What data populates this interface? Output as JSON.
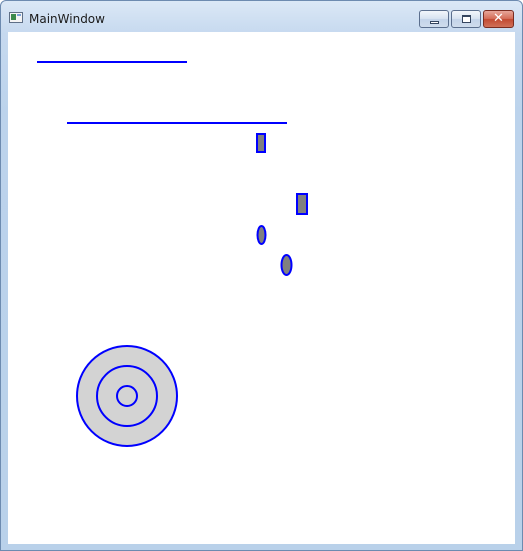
{
  "window": {
    "title": "MainWindow"
  },
  "caption_buttons": {
    "minimize_icon": "minimize-icon",
    "maximize_icon": "maximize-icon",
    "close_icon": "close-icon",
    "close_glyph": "✕"
  },
  "canvas": {
    "stroke_color": "#0000ff",
    "fill_color": "#808080",
    "target_fill": "#d3d3d3"
  }
}
